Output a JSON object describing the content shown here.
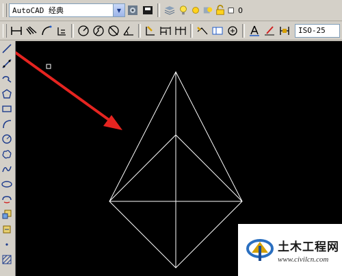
{
  "workspace": {
    "selected": "AutoCAD 经典"
  },
  "layer": {
    "current_name": "0"
  },
  "dimstyle": {
    "current": "ISO-25"
  },
  "watermark": {
    "title": "土木工程网",
    "url": "www.civilcn.com"
  },
  "colors": {
    "canvas": "#000000",
    "lines": "#ffffff",
    "arrow": "#e52420",
    "ui": "#d4d0c8"
  },
  "left_tools": [
    "line-icon",
    "construction-line-icon",
    "polyline-icon",
    "polygon-icon",
    "rectangle-icon",
    "arc-icon",
    "circle-icon",
    "revision-cloud-icon",
    "spline-icon",
    "ellipse-icon",
    "ellipse-arc-icon",
    "insert-block-icon",
    "make-block-icon",
    "point-icon",
    "hatch-icon"
  ]
}
